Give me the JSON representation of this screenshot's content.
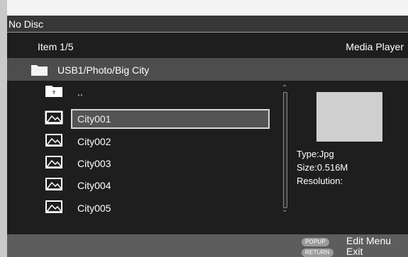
{
  "header": {
    "disc_status": "No Disc"
  },
  "info": {
    "item_counter": "Item 1/5",
    "mode": "Media Player"
  },
  "path": "USB1/Photo/Big City",
  "list": {
    "parent": "..",
    "items": [
      "City001",
      "City002",
      "City003",
      "City004",
      "City005"
    ],
    "selected_index": 0
  },
  "details": {
    "type": "Type:Jpg",
    "size": "Size:0.516M",
    "resolution": "Resolution:"
  },
  "footer": {
    "popup_button": "POPUP",
    "popup_action": "Edit Menu",
    "return_button": "RETURN",
    "return_action": "Exit"
  },
  "colors": {
    "background": "#1e1e1e",
    "path_bar": "#4d4d4d",
    "footer": "#5d5d5d",
    "selection": "#545454"
  },
  "icons": {
    "folder": "folder-icon",
    "parent": "folder-up-icon",
    "image": "image-file-icon"
  }
}
